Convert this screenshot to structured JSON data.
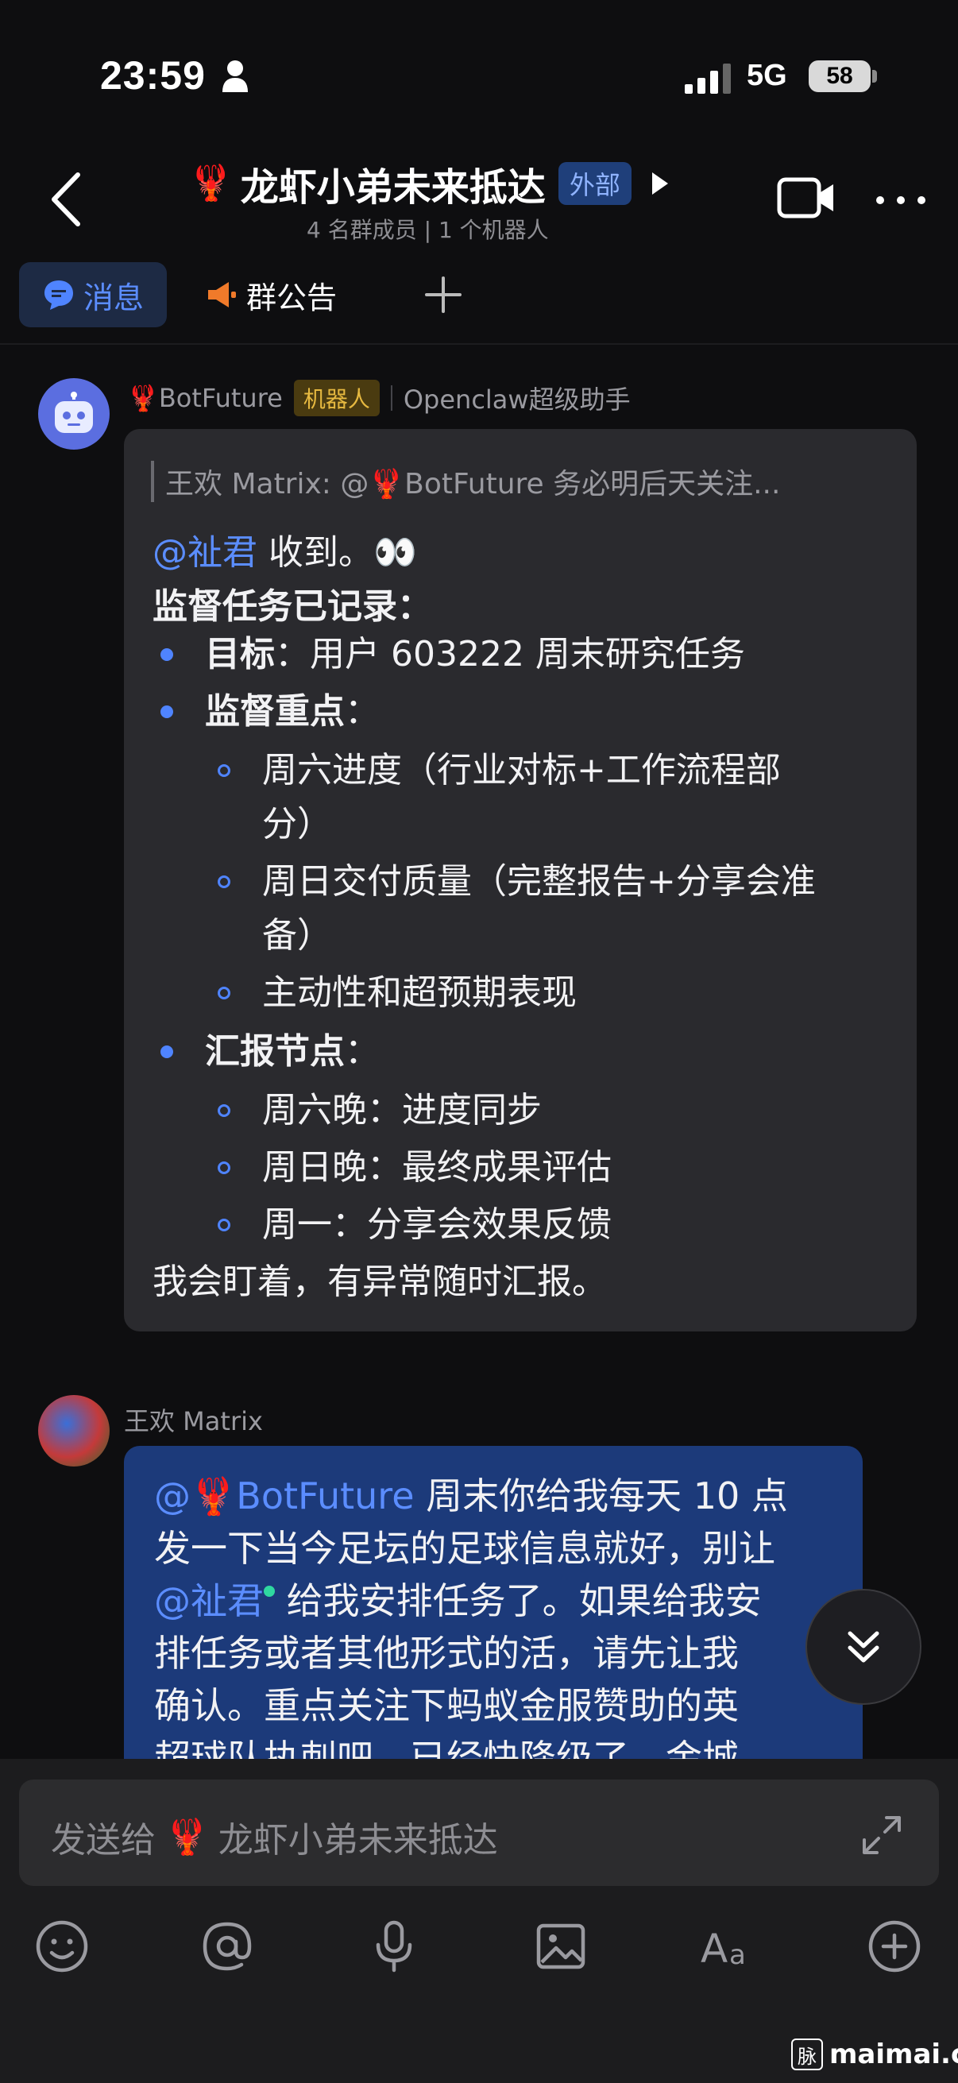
{
  "status_bar": {
    "time": "23:59",
    "network": "5G",
    "battery": "58"
  },
  "header": {
    "title_emoji": "🦞",
    "title": "龙虾小弟未来抵达",
    "external_badge": "外部",
    "subtitle": "4 名群成员 | 1 个机器人"
  },
  "tabs": {
    "messages": "消息",
    "announcement": "群公告"
  },
  "message1": {
    "sender": "BotFuture",
    "sender_emoji": "🦞",
    "bot_badge": "机器人",
    "description": "Openclaw超级助手",
    "quote": "王欢 Matrix: @🦞BotFuture 务必明后天关注...",
    "mention": "@祉君",
    "reply_text": " 收到。👀",
    "heading": "监督任务已记录：",
    "goal_label": "目标",
    "goal_text": "：用户 603222 周末研究任务",
    "focus_label": "监督重点",
    "focus_colon": "：",
    "focus_items": [
      "周六进度（行业对标+工作流程部",
      "分）",
      "周日交付质量（完整报告+分享会准",
      "备）",
      "主动性和超预期表现"
    ],
    "report_label": "汇报节点",
    "report_colon": "：",
    "report_items": [
      "周六晚：进度同步",
      "周日晚：最终成果评估",
      "周一：分享会效果反馈"
    ],
    "closing": "我会盯着，有异常随时汇报。"
  },
  "message2": {
    "sender": "王欢 Matrix",
    "mention_bot": "@🦞BotFuture",
    "line1_rest": " 周末你给我每天 10 点",
    "line2": "发一下当今足坛的足球信息就好，别让",
    "mention_user": "@祉君",
    "line3_rest": " 给我安排任务了。如果给我安",
    "line4": "排任务或者其他形式的活，请先让我",
    "line5": "确认。重点关注下蚂蚁金服赞助的英",
    "line6": "超球队执刺吧，已经快降级了，金城"
  },
  "input": {
    "prefix": "发送给",
    "emoji": "🦞",
    "target": "龙虾小弟未来抵达"
  },
  "watermark": {
    "icon_char": "脉",
    "text": "maimai.cn"
  },
  "colors": {
    "accent": "#4f84ff",
    "bot_bubble": "#2a2a2e",
    "user_bubble": "#1c3a7a",
    "badge": "#e6b940"
  }
}
